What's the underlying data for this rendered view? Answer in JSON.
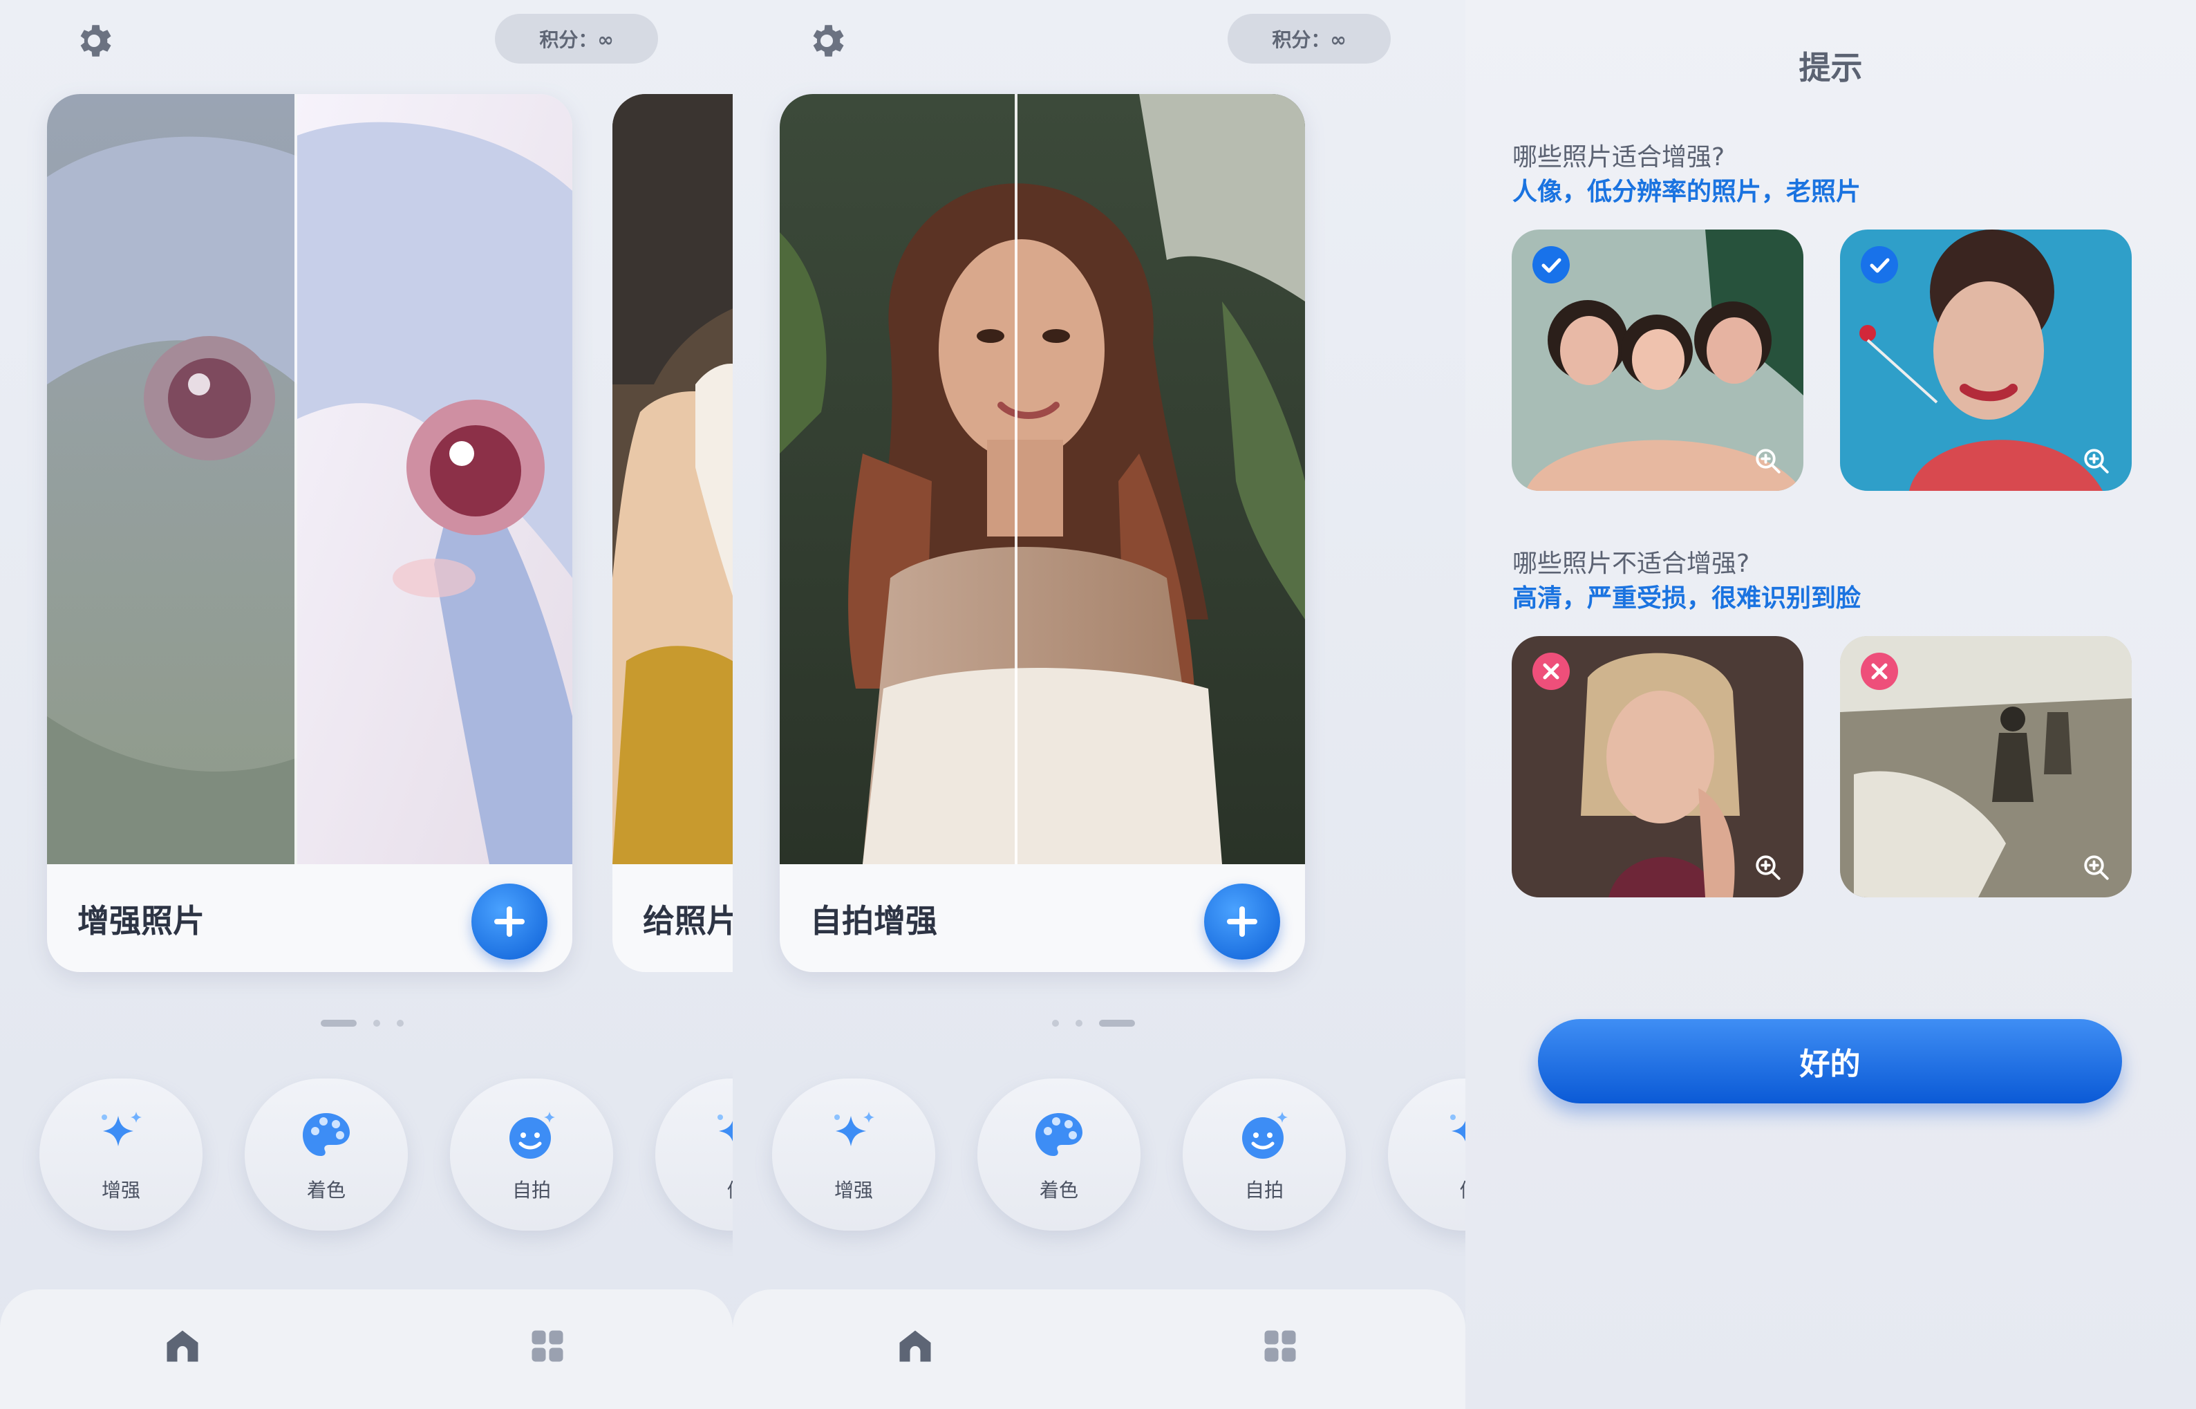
{
  "screens": [
    {
      "points_label": "积分：∞",
      "card_title": "增强照片",
      "peek_title": "给照片",
      "dots_active": 0,
      "features": [
        "增强",
        "着色",
        "自拍",
        "修"
      ]
    },
    {
      "points_label": "积分：∞",
      "card_title": "自拍增强",
      "dots_active": 2,
      "features": [
        "增强",
        "着色",
        "自拍",
        "修"
      ]
    }
  ],
  "tips": {
    "title": "提示",
    "good_question": "哪些照片适合增强?",
    "good_answer": "人像，低分辨率的照片，老照片",
    "bad_question": "哪些照片不适合增强?",
    "bad_answer": "高清，严重受损，很难识别到脸",
    "ok_button": "好的"
  },
  "colors": {
    "accent": "#1a73e0",
    "reject": "#ee4f7a"
  },
  "icons": {
    "settings": "gear-icon",
    "add": "plus-icon",
    "enhance": "sparkle-icon",
    "colorize": "palette-icon",
    "selfie": "smiley-icon",
    "home": "home-icon",
    "apps": "grid-icon",
    "zoom": "zoom-in-icon",
    "good": "check-icon",
    "bad": "close-icon"
  }
}
